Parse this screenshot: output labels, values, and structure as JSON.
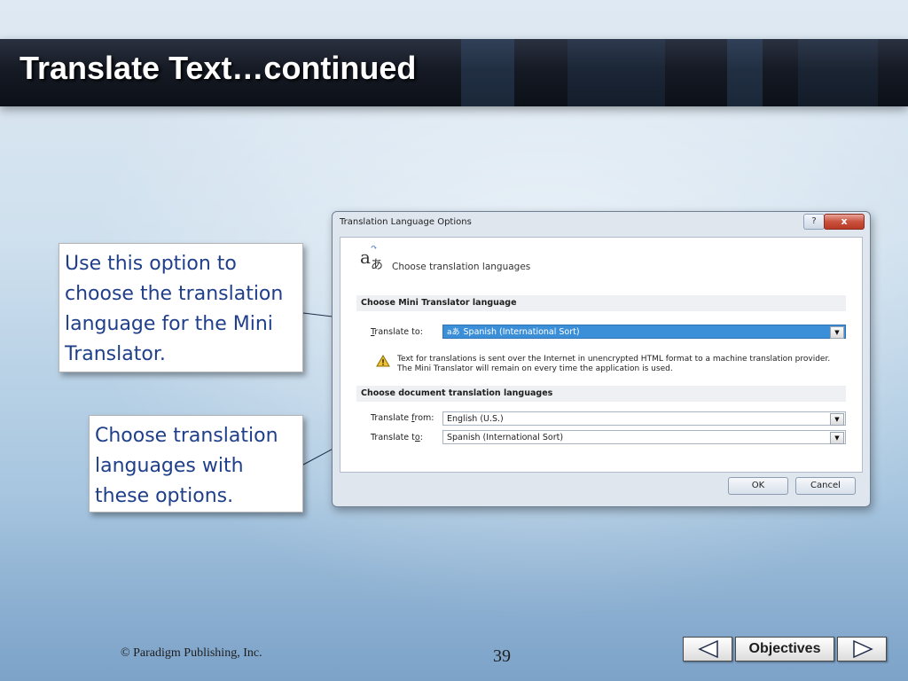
{
  "slide": {
    "title": "Translate Text…continued",
    "callout_top": "Use this option to choose the translation language for the Mini Translator.",
    "callout_bottom": "Choose translation languages with these options."
  },
  "dialog": {
    "title": "Translation Language Options",
    "help_label": "?",
    "close_label": "x",
    "header_icon_text": "a",
    "header_icon_ja": "あ",
    "header_text": "Choose translation languages",
    "section_mini": "Choose Mini Translator language",
    "translate_to_label_u": "T",
    "translate_to_label_rest": "ranslate to:",
    "translate_to_value": "Spanish (International Sort)",
    "warning_line1": "Text for translations is sent over the Internet in unencrypted HTML format to a machine translation provider.",
    "warning_line2": "The Mini Translator will remain on every time the application is used.",
    "section_doc": "Choose document translation languages",
    "translate_from_label_pre": "Translate ",
    "translate_from_label_u": "f",
    "translate_from_label_post": "rom:",
    "translate_from_value": "English (U.S.)",
    "translate_to2_label_pre": "Translate t",
    "translate_to2_label_u": "o",
    "translate_to2_label_post": ":",
    "translate_to2_value": "Spanish (International Sort)",
    "ok_label": "OK",
    "cancel_label": "Cancel",
    "warning_icon": "warning-triangle",
    "dropdown_icon": "chevron-down"
  },
  "footer": {
    "copyright": "© Paradigm Publishing, Inc.",
    "page_number": "39",
    "objectives_label": "Objectives",
    "prev_icon": "left-triangle",
    "next_icon": "right-triangle"
  },
  "colors": {
    "title_bar": "#151a24",
    "callout_text": "#1f3f8a",
    "selected_combo": "#3b8fd8",
    "close_button": "#c9513d"
  }
}
